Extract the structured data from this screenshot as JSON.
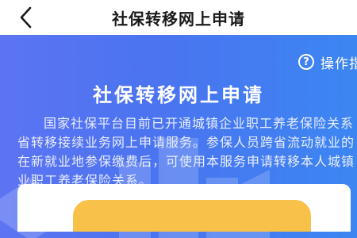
{
  "nav": {
    "title": "社保转移网上申请",
    "back_icon": "chevron-left-icon"
  },
  "banner": {
    "guide_label": "操作指",
    "guide_icon_glyph": "?",
    "headline": "社保转移网上申请",
    "intro_lines": [
      "国家社保平台目前已开通城镇企业职工养老保险关系",
      "省转移接续业务网上申请服务。参保人员跨省流动就业的",
      "在新就业地参保缴费后，可使用本服务申请转移本人城镇",
      "业职工养老保险关系。"
    ]
  },
  "colors": {
    "banner_start": "#5c74f2",
    "banner_end": "#3c86f2",
    "button": "#f8c24a",
    "text_dark": "#1a1a1a"
  }
}
